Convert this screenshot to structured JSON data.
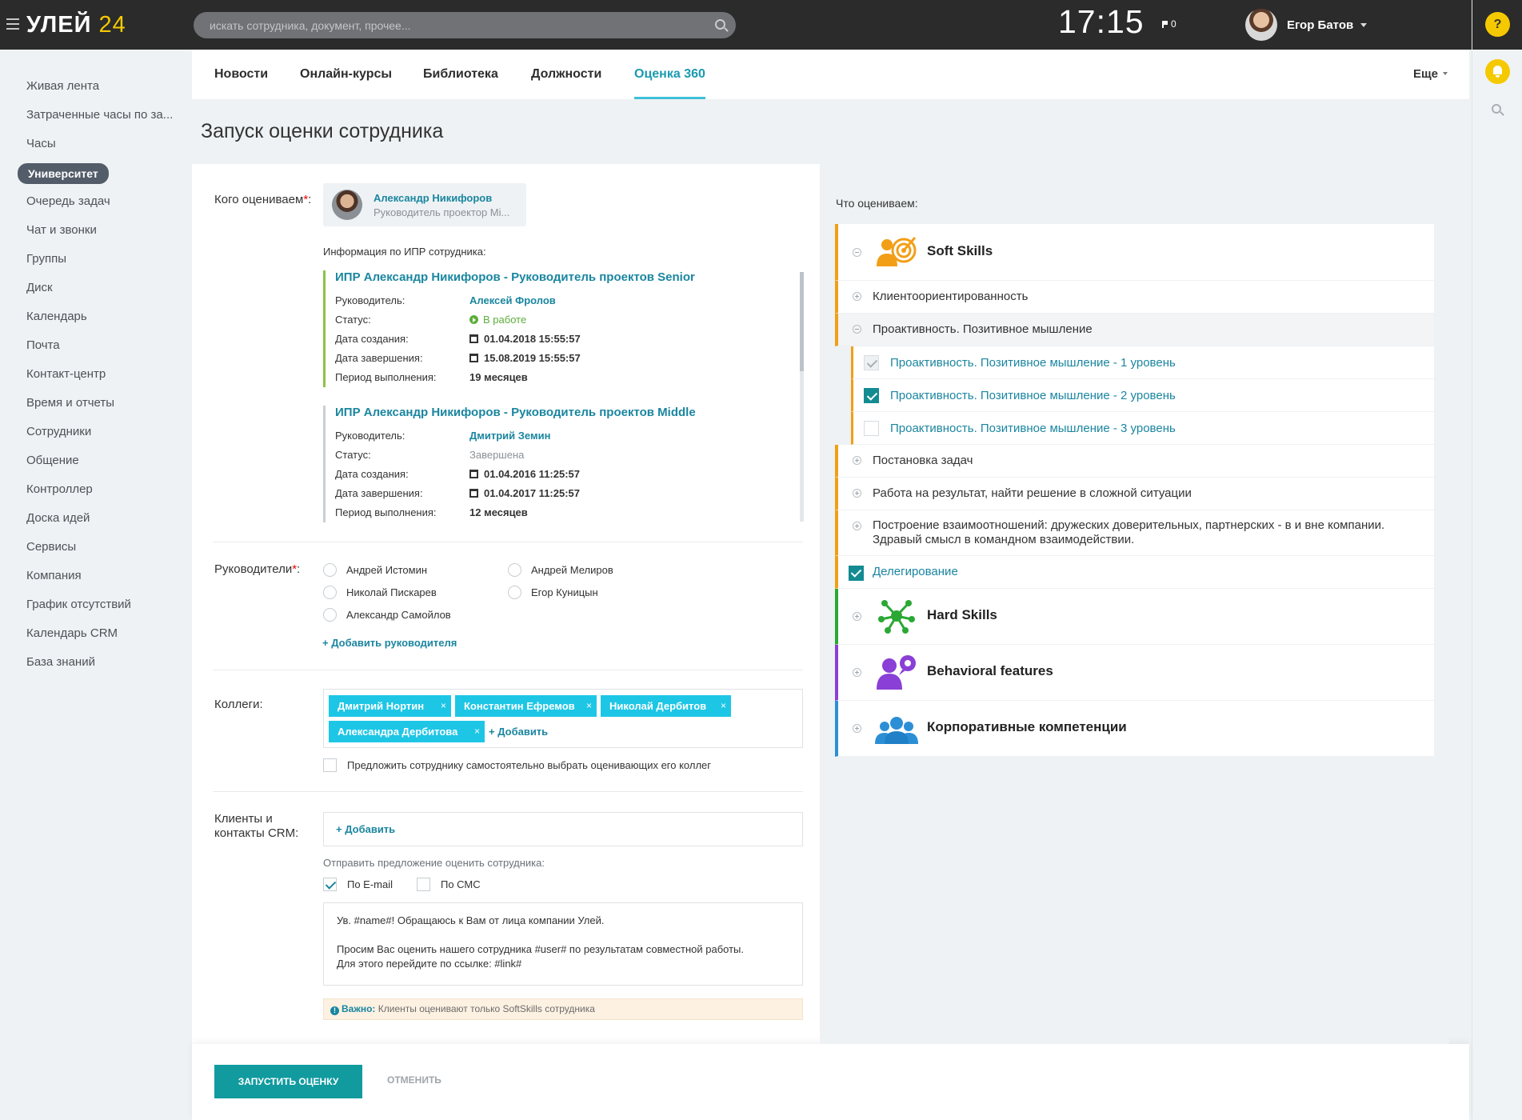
{
  "app": {
    "logo_main": "УЛЕЙ",
    "logo_num": "24",
    "search_placeholder": "искать сотрудника, документ, прочее...",
    "clock": "17:15",
    "flag_count": "0",
    "user_name": "Егор Батов",
    "help": "?"
  },
  "sidebar": {
    "items": [
      {
        "label": "Живая лента"
      },
      {
        "label": "Затраченные часы по за..."
      },
      {
        "label": "Часы"
      },
      {
        "label": "Университет",
        "active": true
      },
      {
        "label": "Очередь задач"
      },
      {
        "label": "Чат и звонки"
      },
      {
        "label": "Группы"
      },
      {
        "label": "Диск"
      },
      {
        "label": "Календарь"
      },
      {
        "label": "Почта"
      },
      {
        "label": "Контакт-центр"
      },
      {
        "label": "Время и отчеты"
      },
      {
        "label": "Сотрудники"
      },
      {
        "label": "Общение"
      },
      {
        "label": "Контроллер"
      },
      {
        "label": "Доска идей"
      },
      {
        "label": "Сервисы"
      },
      {
        "label": "Компания"
      },
      {
        "label": "График отсутствий"
      },
      {
        "label": "Календарь CRM"
      },
      {
        "label": "База знаний"
      }
    ]
  },
  "tabs": {
    "items": [
      {
        "label": "Новости"
      },
      {
        "label": "Онлайн-курсы"
      },
      {
        "label": "Библиотека"
      },
      {
        "label": "Должности"
      },
      {
        "label": "Оценка 360",
        "active": true
      }
    ],
    "more": "Еще"
  },
  "page": {
    "title": "Запуск оценки сотрудника"
  },
  "form": {
    "who_label": "Кого оцениваем",
    "who_name": "Александр Никифоров",
    "who_role": "Руководитель проектор Mi...",
    "ipr_info_title": "Информация по ИПР сотрудника:",
    "ipr": [
      {
        "title": "ИПР Александр Никифоров - Руководитель проектов Senior",
        "manager_k": "Руководитель:",
        "manager_v": "Алексей Фролов",
        "status_k": "Статус:",
        "status_v": "В работе",
        "created_k": "Дата создания:",
        "created_v": "01.04.2018 15:55:57",
        "finished_k": "Дата завершения:",
        "finished_v": "15.08.2019 15:55:57",
        "period_k": "Период выполнения:",
        "period_v": "19 месяцев"
      },
      {
        "title": "ИПР Александр Никифоров - Руководитель проектов Middle",
        "manager_k": "Руководитель:",
        "manager_v": "Дмитрий Земин",
        "status_k": "Статус:",
        "status_v": "Завершена",
        "created_k": "Дата создания:",
        "created_v": "01.04.2016 11:25:57",
        "finished_k": "Дата завершения:",
        "finished_v": "01.04.2017 11:25:57",
        "period_k": "Период выполнения:",
        "period_v": "12 месяцев"
      }
    ],
    "managers_label": "Руководители",
    "managers": [
      "Андрей Истомин",
      "Андрей Мелиров",
      "Николай Пискарев",
      "Егор Куницын",
      "Александр Самойлов"
    ],
    "add_manager": "+ Добавить руководителя",
    "colleagues_label": "Коллеги:",
    "colleagues": [
      "Дмитрий Нортин",
      "Константин Ефремов",
      "Николай Дербитов",
      "Александра Дербитова"
    ],
    "tag_remove": "×",
    "add": "+ Добавить",
    "self_choose": "Предложить сотруднику самостоятельно выбрать оценивающих его коллег",
    "clients_label": "Клиенты и контакты CRM:",
    "send_offer": "Отправить предложение оценить сотрудника:",
    "by_email": "По E-mail",
    "by_sms": "По СМС",
    "message": "Ув. #name#! Обращаюсь к Вам от лица компании Улей.\n\nПросим Вас оценить нашего сотрудника #user# по результатам совместной работы.\nДля этого перейдите по ссылке: #link#",
    "important_label": "Важно:",
    "important_text": "Клиенты оценивают только SoftSkills сотрудника",
    "start_button": "ЗАПУСТИТЬ ОЦЕНКУ",
    "cancel_button": "ОТМЕНИТЬ"
  },
  "panel": {
    "title": "Что оцениваем:",
    "soft": "Soft Skills",
    "soft_items": [
      "Клиентоориентированность",
      "Проактивность. Позитивное мышление"
    ],
    "sub_items": [
      {
        "label": "Проактивность. Позитивное мышление - 1 уровень",
        "state": "disabled-checked"
      },
      {
        "label": "Проактивность. Позитивное мышление - 2 уровень",
        "state": "checked"
      },
      {
        "label": "Проактивность. Позитивное мышление - 3 уровень",
        "state": "unchecked"
      }
    ],
    "more_items": [
      "Постановка задач",
      "Работа на результат, найти решение в сложной ситуации"
    ],
    "relations_1": "Построение взаимоотношений: дружеских доверительных, партнерских - в и вне компании.",
    "relations_2": "Здравый смысл в командном взаимодействии.",
    "delegation": "Делегирование",
    "hard": "Hard Skills",
    "behavioral": "Behavioral features",
    "corporate": "Корпоративные компетенции"
  },
  "colors": {
    "accent": "#1a86a0",
    "button": "#119b9f",
    "soft": "#f29f17",
    "hard": "#2aa834",
    "behavioral": "#8a3fd6",
    "corporate": "#2c8fd6",
    "ipr_active": "#8bc34a"
  }
}
